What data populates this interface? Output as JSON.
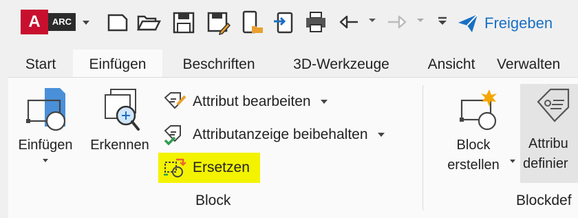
{
  "app": {
    "logo_letter": "A",
    "logo_badge": "ARC"
  },
  "quick_access": {
    "buttons": [
      "new-icon",
      "open-icon",
      "save-icon",
      "save-as-icon",
      "open-from-mobile-icon",
      "export-icon",
      "print-icon",
      "undo-icon",
      "redo-icon"
    ],
    "share_label": "Freigeben",
    "accent": "#1a6fc4"
  },
  "tabs": [
    {
      "label": "Start"
    },
    {
      "label": "Einfügen",
      "active": true
    },
    {
      "label": "Beschriften"
    },
    {
      "label": "3D-Werkzeuge"
    },
    {
      "label": "Ansicht"
    },
    {
      "label": "Verwalten"
    }
  ],
  "panels": {
    "block": {
      "title": "Block",
      "insert_label": "Einfügen",
      "recognize_label": "Erkennen",
      "edit_attribute_label": "Attribut bearbeiten",
      "keep_attribute_display_label": "Attributanzeige beibehalten",
      "replace_label": "Ersetzen"
    },
    "block_definition": {
      "title": "Blockdef",
      "create_block_line1": "Block",
      "create_block_line2": "erstellen",
      "define_attribute_line1": "Attribu",
      "define_attribute_line2": "definier"
    }
  },
  "highlight_color": "#f3f300"
}
